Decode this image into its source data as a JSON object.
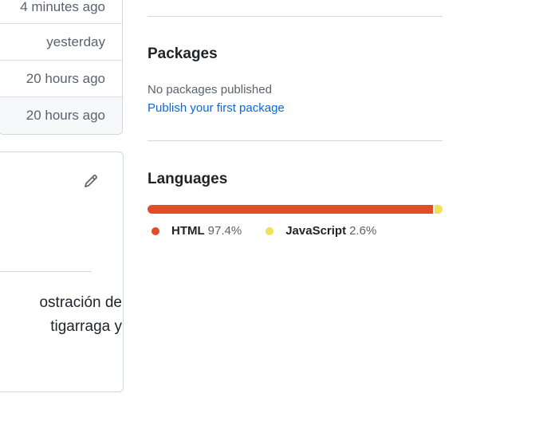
{
  "files": {
    "rows": [
      {
        "time": "4 minutes ago"
      },
      {
        "time": "yesterday"
      },
      {
        "time": "20 hours ago"
      },
      {
        "time": "20 hours ago"
      }
    ]
  },
  "about": {
    "description": "ostración de\ntigarraga y"
  },
  "packages": {
    "title": "Packages",
    "empty_text": "No packages published",
    "publish_link": "Publish your first package"
  },
  "languages": {
    "title": "Languages",
    "items": [
      {
        "name": "HTML",
        "percent": "97.4%",
        "value": 97.4,
        "color": "#e34c26"
      },
      {
        "name": "JavaScript",
        "percent": "2.6%",
        "value": 2.6,
        "color": "#f1e05a"
      }
    ]
  },
  "icons": {
    "edit": "pencil-icon"
  }
}
